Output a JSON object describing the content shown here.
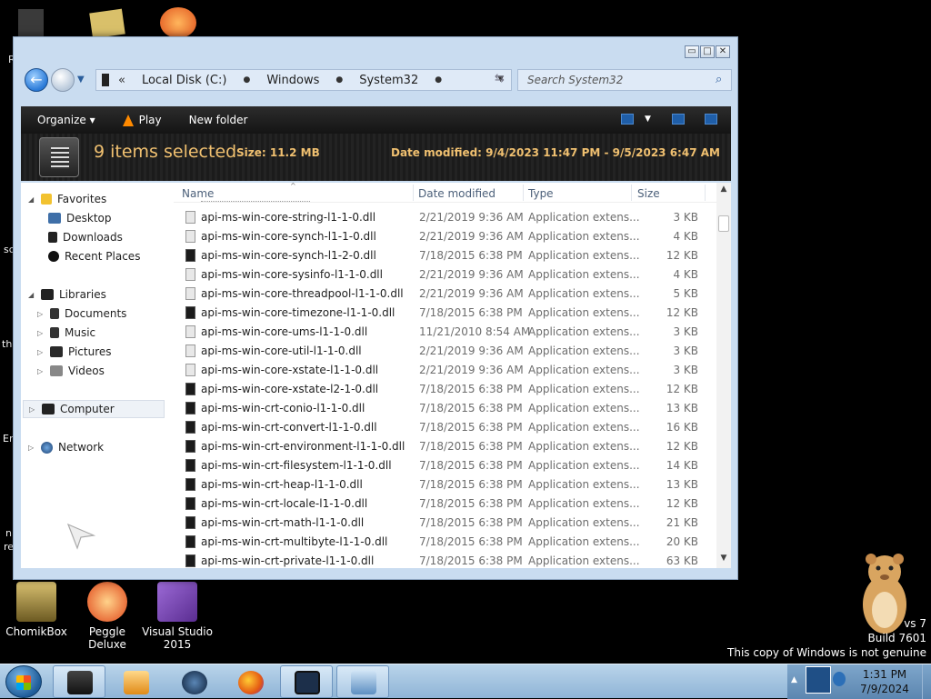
{
  "desktop": {
    "icons": [
      {
        "label": "ChomikBox"
      },
      {
        "label": "Peggle Deluxe"
      },
      {
        "label": "Visual Studio 2015"
      }
    ],
    "edge_texts": [
      "R",
      "sc",
      "th",
      "Er",
      "n",
      "re"
    ],
    "watermark": {
      "line1": "vs 7",
      "line2": "Build 7601",
      "line3": "This copy of Windows is not genuine"
    }
  },
  "window": {
    "controls": {
      "minimize": "▭",
      "maximize": "□",
      "close": "✕"
    },
    "address": {
      "segments": [
        "Local Disk (C:)",
        "Windows",
        "System32"
      ],
      "chevron": "«",
      "separator": "●"
    },
    "search": {
      "placeholder": "Search System32"
    },
    "toolbar": {
      "organize": "Organize ▾",
      "play": "Play",
      "new_folder": "New folder"
    },
    "details": {
      "count": "9 items selected",
      "size_label": "Size: 11.2 MB",
      "date_label": "Date modified: 9/4/2023 11:47 PM - 9/5/2023 6:47 AM"
    },
    "nav": {
      "favorites": "Favorites",
      "desktop": "Desktop",
      "downloads": "Downloads",
      "recent": "Recent Places",
      "libraries": "Libraries",
      "documents": "Documents",
      "music": "Music",
      "pictures": "Pictures",
      "videos": "Videos",
      "computer": "Computer",
      "network": "Network"
    },
    "columns": {
      "name": "Name",
      "date": "Date modified",
      "type": "Type",
      "size": "Size"
    },
    "files": [
      {
        "name": "api-ms-win-core-string-l1-1-0.dll",
        "date": "2/21/2019 9:36 AM",
        "type": "Application extens...",
        "size": "3 KB",
        "icon": "light"
      },
      {
        "name": "api-ms-win-core-synch-l1-1-0.dll",
        "date": "2/21/2019 9:36 AM",
        "type": "Application extens...",
        "size": "4 KB",
        "icon": "light"
      },
      {
        "name": "api-ms-win-core-synch-l1-2-0.dll",
        "date": "7/18/2015 6:38 PM",
        "type": "Application extens...",
        "size": "12 KB",
        "icon": "dark"
      },
      {
        "name": "api-ms-win-core-sysinfo-l1-1-0.dll",
        "date": "2/21/2019 9:36 AM",
        "type": "Application extens...",
        "size": "4 KB",
        "icon": "light"
      },
      {
        "name": "api-ms-win-core-threadpool-l1-1-0.dll",
        "date": "2/21/2019 9:36 AM",
        "type": "Application extens...",
        "size": "5 KB",
        "icon": "light"
      },
      {
        "name": "api-ms-win-core-timezone-l1-1-0.dll",
        "date": "7/18/2015 6:38 PM",
        "type": "Application extens...",
        "size": "12 KB",
        "icon": "dark"
      },
      {
        "name": "api-ms-win-core-ums-l1-1-0.dll",
        "date": "11/21/2010 8:54 AM",
        "type": "Application extens...",
        "size": "3 KB",
        "icon": "light"
      },
      {
        "name": "api-ms-win-core-util-l1-1-0.dll",
        "date": "2/21/2019 9:36 AM",
        "type": "Application extens...",
        "size": "3 KB",
        "icon": "light"
      },
      {
        "name": "api-ms-win-core-xstate-l1-1-0.dll",
        "date": "2/21/2019 9:36 AM",
        "type": "Application extens...",
        "size": "3 KB",
        "icon": "light"
      },
      {
        "name": "api-ms-win-core-xstate-l2-1-0.dll",
        "date": "7/18/2015 6:38 PM",
        "type": "Application extens...",
        "size": "12 KB",
        "icon": "dark"
      },
      {
        "name": "api-ms-win-crt-conio-l1-1-0.dll",
        "date": "7/18/2015 6:38 PM",
        "type": "Application extens...",
        "size": "13 KB",
        "icon": "dark"
      },
      {
        "name": "api-ms-win-crt-convert-l1-1-0.dll",
        "date": "7/18/2015 6:38 PM",
        "type": "Application extens...",
        "size": "16 KB",
        "icon": "dark"
      },
      {
        "name": "api-ms-win-crt-environment-l1-1-0.dll",
        "date": "7/18/2015 6:38 PM",
        "type": "Application extens...",
        "size": "12 KB",
        "icon": "dark"
      },
      {
        "name": "api-ms-win-crt-filesystem-l1-1-0.dll",
        "date": "7/18/2015 6:38 PM",
        "type": "Application extens...",
        "size": "14 KB",
        "icon": "dark"
      },
      {
        "name": "api-ms-win-crt-heap-l1-1-0.dll",
        "date": "7/18/2015 6:38 PM",
        "type": "Application extens...",
        "size": "13 KB",
        "icon": "dark"
      },
      {
        "name": "api-ms-win-crt-locale-l1-1-0.dll",
        "date": "7/18/2015 6:38 PM",
        "type": "Application extens...",
        "size": "12 KB",
        "icon": "dark"
      },
      {
        "name": "api-ms-win-crt-math-l1-1-0.dll",
        "date": "7/18/2015 6:38 PM",
        "type": "Application extens...",
        "size": "21 KB",
        "icon": "dark"
      },
      {
        "name": "api-ms-win-crt-multibyte-l1-1-0.dll",
        "date": "7/18/2015 6:38 PM",
        "type": "Application extens...",
        "size": "20 KB",
        "icon": "dark"
      },
      {
        "name": "api-ms-win-crt-private-l1-1-0.dll",
        "date": "7/18/2015 6:38 PM",
        "type": "Application extens...",
        "size": "63 KB",
        "icon": "dark"
      }
    ]
  },
  "taskbar": {
    "clock_time": "1:31 PM",
    "clock_date": "7/9/2024"
  },
  "colors": {
    "accent_gold": "#f0c070",
    "taskbar": "#a7c6e2",
    "toolbar_dark": "#1e1e1e"
  }
}
